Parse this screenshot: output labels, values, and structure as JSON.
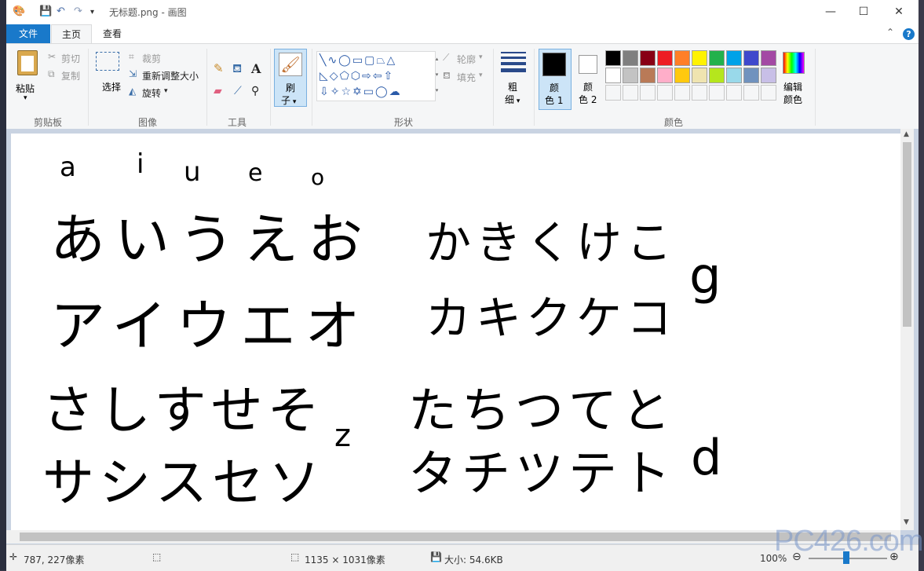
{
  "window": {
    "title": "无标题.png - 画图",
    "quick_access_icons": [
      "paint-app-icon",
      "save-icon",
      "undo-icon",
      "redo-icon",
      "customize-dropdown-icon"
    ]
  },
  "tabs": [
    {
      "label": "文件"
    },
    {
      "label": "主页"
    },
    {
      "label": "查看"
    }
  ],
  "ribbon": {
    "clipboard": {
      "label": "剪贴板",
      "paste": "粘贴",
      "cut": "剪切",
      "copy": "复制"
    },
    "image": {
      "label": "图像",
      "select": "选择",
      "select2": "择",
      "crop": "裁剪",
      "resize": "重新调整大小",
      "rotate": "旋转"
    },
    "tools": {
      "label": "工具"
    },
    "brush": {
      "label1": "刷",
      "label2": "子"
    },
    "shapes": {
      "label": "形状",
      "outline": "轮廓",
      "fill": "填充"
    },
    "size": {
      "label1": "粗",
      "label2": "细"
    },
    "colors": {
      "label": "颜色",
      "color1_a": "颜",
      "color1_b": "色 1",
      "color2_a": "颜",
      "color2_b": "色 2",
      "edit_a": "编辑",
      "edit_b": "颜色",
      "color1": "#000000",
      "color2": "#ffffff",
      "palette_row1": [
        "#000000",
        "#7f7f7f",
        "#880015",
        "#ed1c24",
        "#ff7f27",
        "#fff200",
        "#22b14c",
        "#00a2e8",
        "#3f48cc",
        "#a349a4"
      ],
      "palette_row2": [
        "#ffffff",
        "#c3c3c3",
        "#b97a57",
        "#ffaec9",
        "#ffc90e",
        "#efe4b0",
        "#b5e61d",
        "#99d9ea",
        "#7092be",
        "#c8bfe7"
      ]
    }
  },
  "canvas": {
    "handwriting": {
      "romaji": [
        "a",
        "i",
        "u",
        "e",
        "o"
      ],
      "hiragana_a": "あいうえお",
      "katakana_a": "アイウエオ",
      "hiragana_k": "かきくけこ",
      "katakana_k": "カキクケコ",
      "hiragana_s": "さしすせそ",
      "katakana_s": "サシスセソ",
      "hiragana_t": "たちつてと",
      "katakana_t": "タチツテト",
      "letter_g": "g",
      "letter_z": "z",
      "letter_d": "d"
    }
  },
  "status": {
    "cursor": "787, 227像素",
    "dimensions": "1135 × 1031像素",
    "size": "大小: 54.6KB",
    "zoom": "100%"
  },
  "watermark": "PC426.com"
}
